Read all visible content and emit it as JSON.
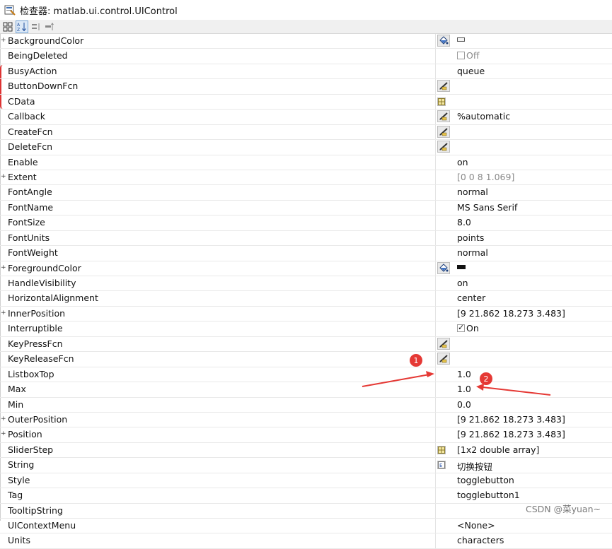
{
  "window": {
    "title": "检查器:  matlab.ui.control.UIControl"
  },
  "toolbar": {
    "buttons": [
      "categorized-icon",
      "sort-alpha-icon",
      "expand-all-icon",
      "collapse-all-icon"
    ]
  },
  "properties": [
    {
      "name": "BackgroundColor",
      "expandable": true,
      "button": "paint-icon",
      "value": "",
      "value_type": "swatch-light"
    },
    {
      "name": "BeingDeleted",
      "value": "Off",
      "value_type": "checkbox-unchecked-grey"
    },
    {
      "name": "BusyAction",
      "value": "queue"
    },
    {
      "name": "ButtonDownFcn",
      "button": "edit-pen-icon",
      "value": ""
    },
    {
      "name": "CData",
      "button": "table-icon",
      "value": ""
    },
    {
      "name": "Callback",
      "button": "edit-pen-icon",
      "value": "%automatic"
    },
    {
      "name": "CreateFcn",
      "button": "edit-pen-icon",
      "value": ""
    },
    {
      "name": "DeleteFcn",
      "button": "edit-pen-icon",
      "value": ""
    },
    {
      "name": "Enable",
      "value": "on"
    },
    {
      "name": "Extent",
      "expandable": true,
      "value": "[0 0 8 1.069]",
      "value_type": "grey"
    },
    {
      "name": "FontAngle",
      "value": "normal"
    },
    {
      "name": "FontName",
      "value": "MS Sans Serif"
    },
    {
      "name": "FontSize",
      "value": "8.0"
    },
    {
      "name": "FontUnits",
      "value": "points"
    },
    {
      "name": "FontWeight",
      "value": "normal"
    },
    {
      "name": "ForegroundColor",
      "expandable": true,
      "button": "paint-icon",
      "value": "",
      "value_type": "swatch-dark"
    },
    {
      "name": "HandleVisibility",
      "value": "on"
    },
    {
      "name": "HorizontalAlignment",
      "value": "center"
    },
    {
      "name": "InnerPosition",
      "expandable": true,
      "value": "[9 21.862 18.273 3.483]"
    },
    {
      "name": "Interruptible",
      "value": "On",
      "value_type": "checkbox-checked"
    },
    {
      "name": "KeyPressFcn",
      "button": "edit-pen-icon",
      "value": ""
    },
    {
      "name": "KeyReleaseFcn",
      "button": "edit-pen-icon",
      "value": ""
    },
    {
      "name": "ListboxTop",
      "value": "1.0"
    },
    {
      "name": "Max",
      "value": "1.0"
    },
    {
      "name": "Min",
      "value": "0.0"
    },
    {
      "name": "OuterPosition",
      "expandable": true,
      "value": "[9 21.862 18.273 3.483]"
    },
    {
      "name": "Position",
      "expandable": true,
      "value": "[9 21.862 18.273 3.483]"
    },
    {
      "name": "SliderStep",
      "button": "table-icon",
      "value": "[1x2  double array]"
    },
    {
      "name": "String",
      "button": "string-editor-icon",
      "value": "切换按钮"
    },
    {
      "name": "Style",
      "value": "togglebutton"
    },
    {
      "name": "Tag",
      "value": "togglebutton1"
    },
    {
      "name": "TooltipString",
      "value": ""
    },
    {
      "name": "UIContextMenu",
      "value": "<None>"
    },
    {
      "name": "Units",
      "value": "characters"
    }
  ],
  "annotations": {
    "badge1": "1",
    "badge2": "2",
    "color": "#e53935"
  },
  "watermark": "CSDN @菜yuan~"
}
